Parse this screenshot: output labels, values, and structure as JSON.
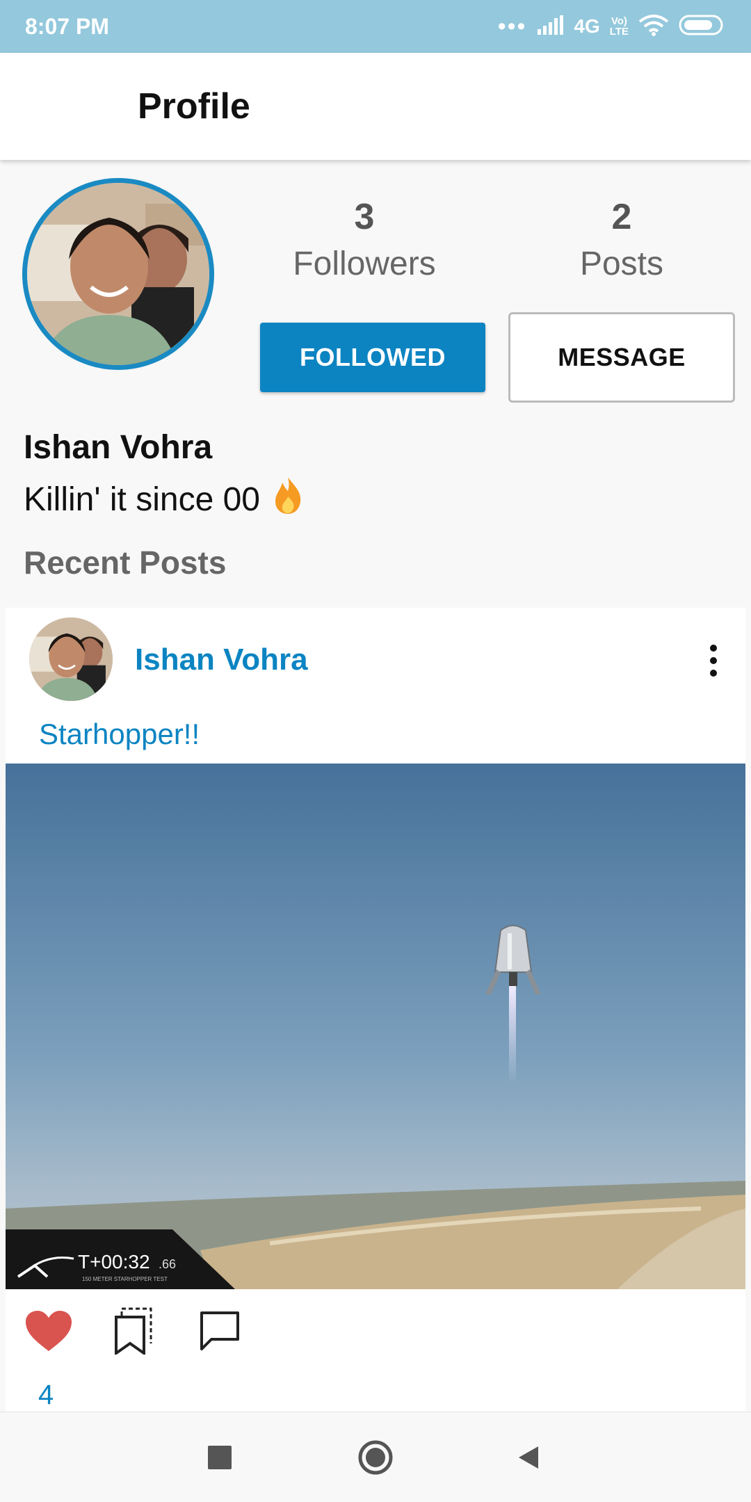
{
  "status_bar": {
    "time": "8:07 PM",
    "dots": "•••",
    "network": "4G",
    "volte": "Vo\nLTE",
    "icons": [
      "signal-icon",
      "wifi-icon",
      "battery-icon"
    ]
  },
  "app_bar": {
    "title": "Profile"
  },
  "profile": {
    "followers_count": "3",
    "followers_label": "Followers",
    "posts_count": "2",
    "posts_label": "Posts",
    "followed_button": "FOLLOWED",
    "message_button": "MESSAGE",
    "name": "Ishan Vohra",
    "bio": "Killin' it since 00",
    "bio_emoji_icon": "fire-icon"
  },
  "recent_posts": {
    "title": "Recent Posts",
    "posts": [
      {
        "author": "Ishan Vohra",
        "caption": "Starhopper!!",
        "image_overlay": {
          "timer": "T+00:32",
          "timer_fraction": ".66",
          "subtitle": "150 METER STARHOPPER TEST"
        },
        "likes": "4",
        "liked": true
      }
    ]
  },
  "colors": {
    "status_bar": "#94c8dc",
    "accent": "#0c84c2",
    "like": "#d9534f"
  },
  "nav": {
    "items": [
      "recents-icon",
      "home-icon",
      "back-icon"
    ]
  }
}
